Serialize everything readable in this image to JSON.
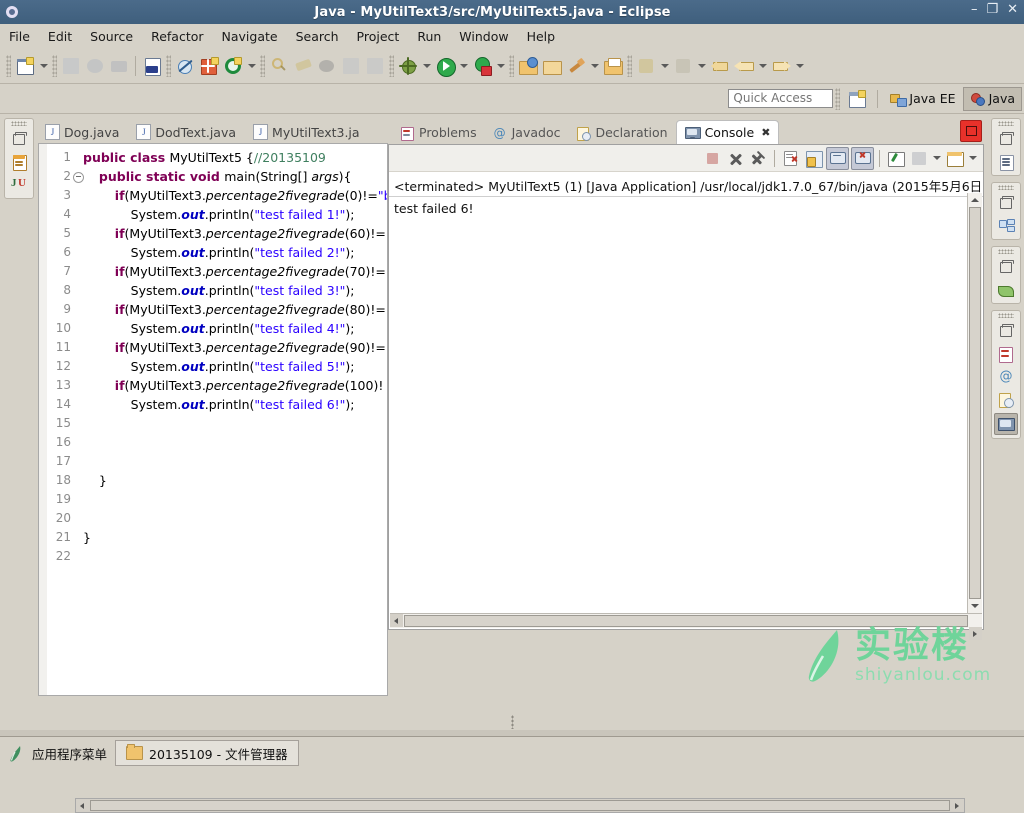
{
  "window": {
    "title": "Java - MyUtilText3/src/MyUtilText5.java - Eclipse",
    "minimize": "–",
    "maximize": "❐",
    "close": "✕",
    "app_icon": "eclipse-gear-icon"
  },
  "menu": [
    {
      "label": "File"
    },
    {
      "label": "Edit"
    },
    {
      "label": "Source"
    },
    {
      "label": "Refactor"
    },
    {
      "label": "Navigate"
    },
    {
      "label": "Search"
    },
    {
      "label": "Project"
    },
    {
      "label": "Run"
    },
    {
      "label": "Window"
    },
    {
      "label": "Help"
    }
  ],
  "toolbar": {
    "items": [
      "new-wizard-icon",
      "new-dropdown-arrow",
      "save-icon",
      "save-all-icon",
      "print-icon",
      "toggle-numeric-icon",
      "skip-breakpoints-icon",
      "build-all-icon",
      "run-last-tool-icon",
      "run-last-tool-arrow",
      "search-icon",
      "annotation-icon",
      "coverage-icon",
      "open-type-icon",
      "open-task-icon",
      "debug-icon",
      "debug-arrow",
      "run-icon",
      "run-arrow",
      "external-tools-icon",
      "external-tools-arrow",
      "new-java-project-icon",
      "new-package-icon",
      "new-class-icon",
      "new-class-arrow",
      "open-resource-icon",
      "next-annotation-icon",
      "next-annotation-arrow",
      "previous-annotation-icon",
      "previous-annotation-arrow",
      "last-edit-location-icon",
      "back-icon",
      "back-arrow",
      "forward-icon",
      "forward-arrow"
    ]
  },
  "quick_access": {
    "placeholder": "Quick Access",
    "new-perspective-icon": "open-perspective-icon",
    "perspectives": [
      {
        "label": "Java EE",
        "icon": "java-ee-perspective-icon",
        "active": false
      },
      {
        "label": "Java",
        "icon": "java-perspective-icon",
        "active": true
      }
    ]
  },
  "left_minimized_bar": {
    "groups": [
      {
        "icons": [
          "restore-icon",
          "package-explorer-icon",
          "junit-icon"
        ]
      }
    ]
  },
  "right_minimized_bar": {
    "groups": [
      {
        "icons": [
          "restore-icon",
          "outline-icon"
        ]
      },
      {
        "icons": [
          "restore-icon",
          "task-list-icon"
        ]
      },
      {
        "icons": [
          "restore-icon",
          "servers-icon"
        ]
      },
      {
        "icons": [
          "restore-icon",
          "problems-icon",
          "javadoc-icon",
          "declaration-icon",
          "console-icon"
        ]
      }
    ]
  },
  "editor": {
    "tabs": [
      {
        "label": "Dog.java",
        "active": false
      },
      {
        "label": "DodText.java",
        "active": false
      },
      {
        "label": "MyUtilText3.ja",
        "active": false
      }
    ],
    "lines": [
      {
        "n": "1",
        "fold": false,
        "segments": [
          {
            "t": "public class ",
            "c": "kw"
          },
          {
            "t": "MyUtilText5 {",
            "c": "pl"
          },
          {
            "t": "//20135109",
            "c": "cm"
          }
        ]
      },
      {
        "n": "2",
        "fold": true,
        "segments": [
          {
            "t": "    ",
            "c": "pl"
          },
          {
            "t": "public static void ",
            "c": "kw"
          },
          {
            "t": "main(String[] ",
            "c": "pl"
          },
          {
            "t": "args",
            "c": "it"
          },
          {
            "t": "){",
            "c": "pl"
          }
        ]
      },
      {
        "n": "3",
        "fold": false,
        "segments": [
          {
            "t": "        ",
            "c": "pl"
          },
          {
            "t": "if",
            "c": "kw"
          },
          {
            "t": "(MyUtilText3.",
            "c": "pl"
          },
          {
            "t": "percentage2fivegrade",
            "c": "it"
          },
          {
            "t": "(0)!=",
            "c": "pl"
          },
          {
            "t": "\"b",
            "c": "st"
          }
        ]
      },
      {
        "n": "4",
        "fold": false,
        "segments": [
          {
            "t": "            System.",
            "c": "pl"
          },
          {
            "t": "out",
            "c": "itb"
          },
          {
            "t": ".println(",
            "c": "pl"
          },
          {
            "t": "\"test failed 1!\"",
            "c": "st"
          },
          {
            "t": ");",
            "c": "pl"
          }
        ]
      },
      {
        "n": "5",
        "fold": false,
        "segments": [
          {
            "t": "        ",
            "c": "pl"
          },
          {
            "t": "if",
            "c": "kw"
          },
          {
            "t": "(MyUtilText3.",
            "c": "pl"
          },
          {
            "t": "percentage2fivegrade",
            "c": "it"
          },
          {
            "t": "(60)!=",
            "c": "pl"
          },
          {
            "t": "\"",
            "c": "st"
          }
        ]
      },
      {
        "n": "6",
        "fold": false,
        "segments": [
          {
            "t": "            System.",
            "c": "pl"
          },
          {
            "t": "out",
            "c": "itb"
          },
          {
            "t": ".println(",
            "c": "pl"
          },
          {
            "t": "\"test failed 2!\"",
            "c": "st"
          },
          {
            "t": ");",
            "c": "pl"
          }
        ]
      },
      {
        "n": "7",
        "fold": false,
        "segments": [
          {
            "t": "        ",
            "c": "pl"
          },
          {
            "t": "if",
            "c": "kw"
          },
          {
            "t": "(MyUtilText3.",
            "c": "pl"
          },
          {
            "t": "percentage2fivegrade",
            "c": "it"
          },
          {
            "t": "(70)!=",
            "c": "pl"
          },
          {
            "t": "\"",
            "c": "st"
          }
        ]
      },
      {
        "n": "8",
        "fold": false,
        "segments": [
          {
            "t": "            System.",
            "c": "pl"
          },
          {
            "t": "out",
            "c": "itb"
          },
          {
            "t": ".println(",
            "c": "pl"
          },
          {
            "t": "\"test failed 3!\"",
            "c": "st"
          },
          {
            "t": ");",
            "c": "pl"
          }
        ]
      },
      {
        "n": "9",
        "fold": false,
        "segments": [
          {
            "t": "        ",
            "c": "pl"
          },
          {
            "t": "if",
            "c": "kw"
          },
          {
            "t": "(MyUtilText3.",
            "c": "pl"
          },
          {
            "t": "percentage2fivegrade",
            "c": "it"
          },
          {
            "t": "(80)!=",
            "c": "pl"
          },
          {
            "t": "\"",
            "c": "st"
          }
        ]
      },
      {
        "n": "10",
        "fold": false,
        "segments": [
          {
            "t": "            System.",
            "c": "pl"
          },
          {
            "t": "out",
            "c": "itb"
          },
          {
            "t": ".println(",
            "c": "pl"
          },
          {
            "t": "\"test failed 4!\"",
            "c": "st"
          },
          {
            "t": ");",
            "c": "pl"
          }
        ]
      },
      {
        "n": "11",
        "fold": false,
        "segments": [
          {
            "t": "        ",
            "c": "pl"
          },
          {
            "t": "if",
            "c": "kw"
          },
          {
            "t": "(MyUtilText3.",
            "c": "pl"
          },
          {
            "t": "percentage2fivegrade",
            "c": "it"
          },
          {
            "t": "(90)!=",
            "c": "pl"
          },
          {
            "t": "\"",
            "c": "st"
          }
        ]
      },
      {
        "n": "12",
        "fold": false,
        "segments": [
          {
            "t": "            System.",
            "c": "pl"
          },
          {
            "t": "out",
            "c": "itb"
          },
          {
            "t": ".println(",
            "c": "pl"
          },
          {
            "t": "\"test failed 5!\"",
            "c": "st"
          },
          {
            "t": ");",
            "c": "pl"
          }
        ]
      },
      {
        "n": "13",
        "fold": false,
        "segments": [
          {
            "t": "        ",
            "c": "pl"
          },
          {
            "t": "if",
            "c": "kw"
          },
          {
            "t": "(MyUtilText3.",
            "c": "pl"
          },
          {
            "t": "percentage2fivegrade",
            "c": "it"
          },
          {
            "t": "(100)!",
            "c": "pl"
          }
        ]
      },
      {
        "n": "14",
        "fold": false,
        "segments": [
          {
            "t": "            System.",
            "c": "pl"
          },
          {
            "t": "out",
            "c": "itb"
          },
          {
            "t": ".println(",
            "c": "pl"
          },
          {
            "t": "\"test failed 6!\"",
            "c": "st"
          },
          {
            "t": ");",
            "c": "pl"
          }
        ]
      },
      {
        "n": "15",
        "fold": false,
        "segments": []
      },
      {
        "n": "16",
        "fold": false,
        "segments": []
      },
      {
        "n": "17",
        "fold": false,
        "segments": []
      },
      {
        "n": "18",
        "fold": false,
        "segments": [
          {
            "t": "    }",
            "c": "pl"
          }
        ]
      },
      {
        "n": "19",
        "fold": false,
        "segments": []
      },
      {
        "n": "20",
        "fold": false,
        "segments": []
      },
      {
        "n": "21",
        "fold": false,
        "segments": [
          {
            "t": "}",
            "c": "pl"
          }
        ]
      },
      {
        "n": "22",
        "fold": false,
        "segments": []
      }
    ]
  },
  "console_panel": {
    "tabs": [
      {
        "label": "Problems",
        "icon": "problems-icon",
        "active": false
      },
      {
        "label": "Javadoc",
        "icon": "javadoc-icon",
        "active": false
      },
      {
        "label": "Declaration",
        "icon": "declaration-icon",
        "active": false
      },
      {
        "label": "Console",
        "icon": "console-icon",
        "active": true,
        "close": "✖"
      }
    ],
    "minimize_button": "restore-console-icon",
    "toolbar_icons": [
      "terminate-icon",
      "remove-launch-icon",
      "remove-all-launches-icon",
      "clear-console-icon",
      "scroll-lock-icon",
      "show-console-on-output-icon",
      "show-console-on-error-icon",
      "pin-console-icon",
      "display-selected-console-icon",
      "display-selected-console-arrow",
      "open-console-icon",
      "open-console-arrow"
    ],
    "header": "<terminated> MyUtilText5 (1) [Java Application] /usr/local/jdk1.7.0_67/bin/java (2015年5月6日",
    "output": "test failed 6!"
  },
  "watermark": {
    "cn": "实验楼",
    "en": "shiyanlou.com",
    "color": "#6fd49a"
  },
  "taskbar": {
    "app_menu": "应用程序菜单",
    "app_menu_icon": "applications-logo-icon",
    "task": "20135109 - 文件管理器",
    "task_icon": "folder-icon"
  }
}
